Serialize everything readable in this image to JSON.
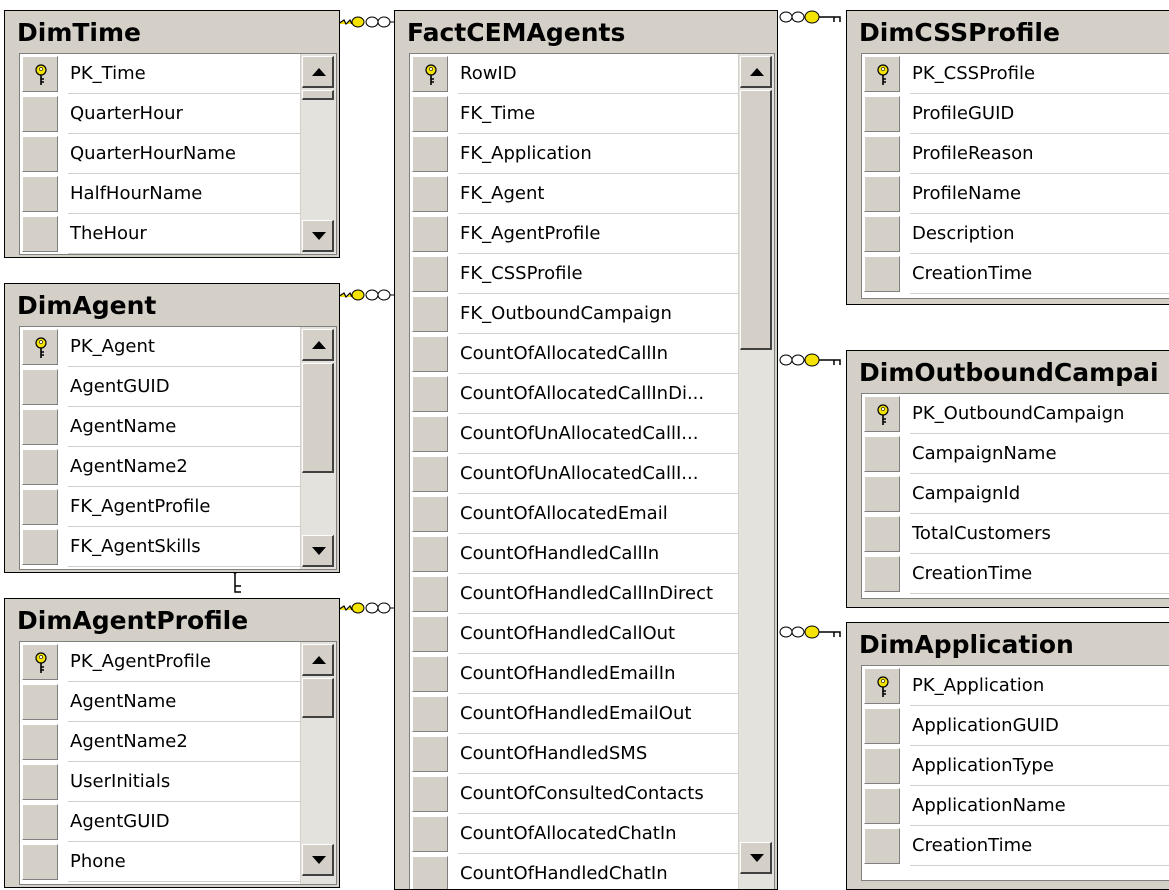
{
  "tables": {
    "dim_time": {
      "name": "DimTime",
      "columns": [
        "PK_Time",
        "QuarterHour",
        "QuarterHourName",
        "HalfHourName",
        "TheHour"
      ]
    },
    "dim_agent": {
      "name": "DimAgent",
      "columns": [
        "PK_Agent",
        "AgentGUID",
        "AgentName",
        "AgentName2",
        "FK_AgentProfile",
        "FK_AgentSkills"
      ]
    },
    "dim_agent_profile": {
      "name": "DimAgentProfile",
      "columns": [
        "PK_AgentProfile",
        "AgentName",
        "AgentName2",
        "UserInitials",
        "AgentGUID",
        "Phone"
      ]
    },
    "fact_cem_agents": {
      "name": "FactCEMAgents",
      "columns": [
        "RowID",
        "FK_Time",
        "FK_Application",
        "FK_Agent",
        "FK_AgentProfile",
        "FK_CSSProfile",
        "FK_OutboundCampaign",
        "CountOfAllocatedCallIn",
        "CountOfAllocatedCallInDi...",
        "CountOfUnAllocatedCallI...",
        "CountOfUnAllocatedCallI...",
        "CountOfAllocatedEmail",
        "CountOfHandledCallIn",
        "CountOfHandledCallInDirect",
        "CountOfHandledCallOut",
        "CountOfHandledEmailIn",
        "CountOfHandledEmailOut",
        "CountOfHandledSMS",
        "CountOfConsultedContacts",
        "CountOfAllocatedChatIn",
        "CountOfHandledChatIn"
      ]
    },
    "dim_css_profile": {
      "name": "DimCSSProfile",
      "columns": [
        "PK_CSSProfile",
        "ProfileGUID",
        "ProfileReason",
        "ProfileName",
        "Description",
        "CreationTime"
      ]
    },
    "dim_outbound_campaign": {
      "name": "DimOutboundCampai",
      "columns": [
        "PK_OutboundCampaign",
        "CampaignName",
        "CampaignId",
        "TotalCustomers",
        "CreationTime"
      ]
    },
    "dim_application": {
      "name": "DimApplication",
      "columns": [
        "PK_Application",
        "ApplicationGUID",
        "ApplicationType",
        "ApplicationName",
        "CreationTime"
      ]
    }
  },
  "icons": {
    "primary_key": "key-icon",
    "relationship": "relationship-connector-icon",
    "scroll_up": "scroll-up-arrow-icon",
    "scroll_down": "scroll-down-arrow-icon"
  },
  "colors": {
    "window_bg": "#d4d0c8",
    "grid_bg": "#ffffff",
    "key_fill": "#f4e300",
    "connector_line": "#000000"
  }
}
